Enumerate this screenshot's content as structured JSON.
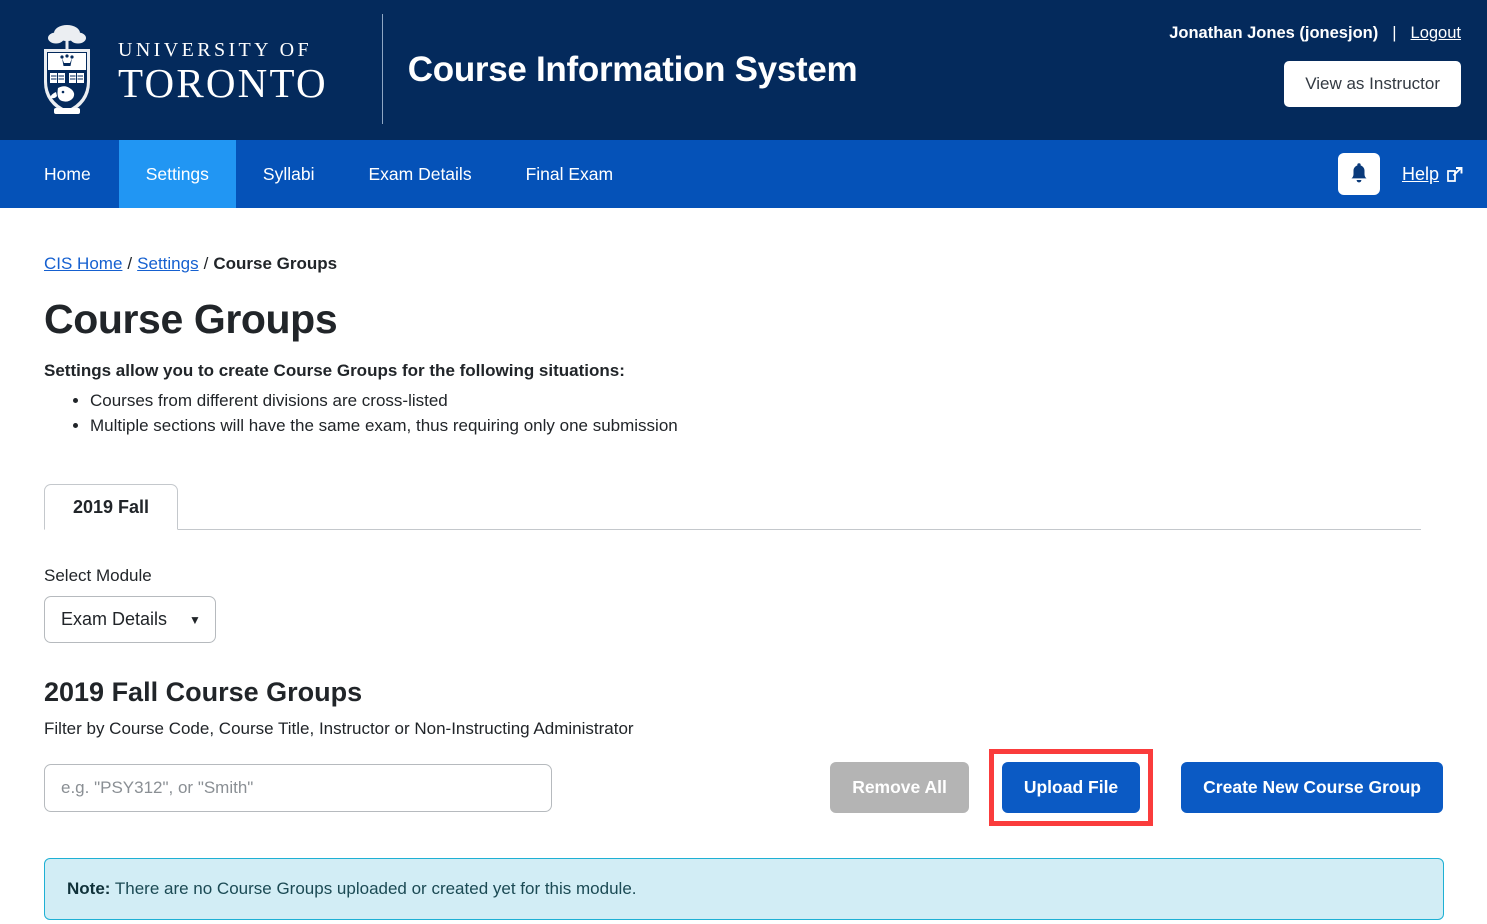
{
  "header": {
    "university_line1": "UNIVERSITY OF",
    "university_line2": "TORONTO",
    "crest_icon": "uoft-crest-icon",
    "app_title": "Course Information System",
    "user_name": "Jonathan Jones (jonesjon)",
    "separator": "|",
    "logout_label": "Logout",
    "view_as_instructor_label": "View as Instructor",
    "bg_color": "#042a5c"
  },
  "nav": {
    "items": [
      {
        "label": "Home",
        "active": false
      },
      {
        "label": "Settings",
        "active": true
      },
      {
        "label": "Syllabi",
        "active": false
      },
      {
        "label": "Exam Details",
        "active": false
      },
      {
        "label": "Final Exam",
        "active": false
      }
    ],
    "bell_icon": "bell-icon",
    "help_label": "Help",
    "help_external_icon": "external-link-icon",
    "bg_color": "#0552b8",
    "active_color": "#2196f3"
  },
  "breadcrumb": {
    "home": "CIS Home",
    "settings": "Settings",
    "current": "Course Groups",
    "separator": "/"
  },
  "page": {
    "title": "Course Groups",
    "lead": "Settings allow you to create Course Groups for the following situations:",
    "situations": [
      "Courses from different divisions are cross-listed",
      "Multiple sections will have the same exam, thus requiring only one submission"
    ]
  },
  "term_tab": {
    "label": "2019 Fall"
  },
  "module_select": {
    "label": "Select Module",
    "value": "Exam Details",
    "caret_icon": "chevron-down-icon"
  },
  "groups": {
    "section_title": "2019 Fall Course Groups",
    "filter_label": "Filter by Course Code, Course Title, Instructor or Non-Instructing Administrator",
    "filter_placeholder": "e.g. \"PSY312\", or \"Smith\"",
    "filter_value": "",
    "remove_all_label": "Remove All",
    "upload_file_label": "Upload File",
    "create_label": "Create New Course Group",
    "highlight_color": "#fa3c3c"
  },
  "note": {
    "prefix": "Note:",
    "text": " There are no Course Groups uploaded or created yet for this module.",
    "bg_color": "#d2edf5",
    "border_color": "#1eb0d4"
  }
}
